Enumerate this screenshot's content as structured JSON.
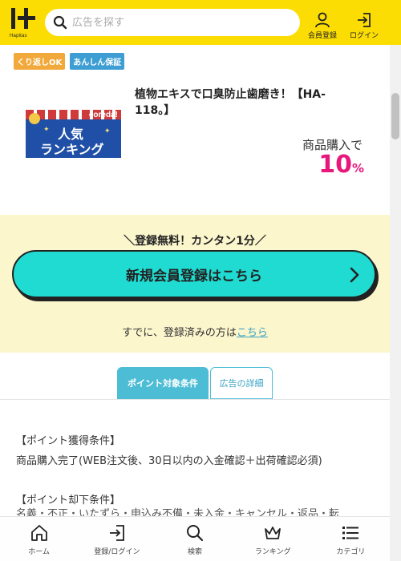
{
  "header": {
    "logo_text": "Hapitas",
    "search_placeholder": "広告を探す",
    "register_label": "会員登録",
    "login_label": "ログイン"
  },
  "badges": [
    "くり返しOK",
    "あんしん保証"
  ],
  "product": {
    "banner": {
      "brand": "coreda!",
      "line1": "人気",
      "line2": "ランキング"
    },
    "title": "植物エキスで口臭防止歯磨き！【HA-118。】",
    "reward_condition": "商品購入で",
    "reward_value": "10",
    "reward_unit": "%"
  },
  "registration": {
    "catch": "＼登録無料！カンタン1分／",
    "button_label": "新規会員登録はこちら",
    "already_text": "すでに、登録済みの方は",
    "already_link": "こちら"
  },
  "tabs": [
    {
      "label": "ポイント対象条件",
      "active": true
    },
    {
      "label": "広告の詳細",
      "active": false
    }
  ],
  "content": {
    "section1_heading": "【ポイント獲得条件】",
    "section1_body": "商品購入完了(WEB注文後、30日以内の入金確認＋出荷確認必須)",
    "section2_heading": "【ポイント却下条件】",
    "section2_partial": "名義・不正・いたずら・申込み不備・未入金・キャンセル・返品・転"
  },
  "bottom_nav": [
    {
      "label": "ホーム",
      "icon": "home-icon"
    },
    {
      "label": "登録/ログイン",
      "icon": "login-icon"
    },
    {
      "label": "検索",
      "icon": "search-icon"
    },
    {
      "label": "ランキング",
      "icon": "crown-icon"
    },
    {
      "label": "カテゴリ",
      "icon": "list-icon"
    }
  ],
  "colors": {
    "header_bg": "#fcdd03",
    "accent_pink": "#e8177c",
    "cta_teal": "#1fdbd1",
    "tab_blue": "#4dbdd6",
    "section_cream": "#fcf6cd"
  }
}
